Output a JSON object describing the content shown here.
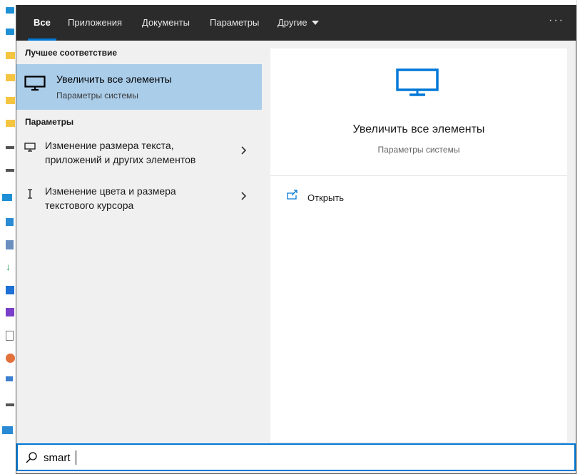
{
  "tabs": [
    {
      "label": "Все"
    },
    {
      "label": "Приложения"
    },
    {
      "label": "Документы"
    },
    {
      "label": "Параметры"
    },
    {
      "label": "Другие"
    }
  ],
  "more_button": {
    "label": "···"
  },
  "best_match": {
    "header": "Лучшее соответствие",
    "title": "Увеличить все элементы",
    "subtitle": "Параметры системы",
    "icon": "monitor-icon"
  },
  "settings_section": {
    "header": "Параметры",
    "items": [
      {
        "line1": "Изменение размера текста,",
        "line2": "приложений и других элементов",
        "icon": "monitor-icon"
      },
      {
        "line1": "Изменение цвета и размера",
        "line2": "текстового курсора",
        "icon": "text-cursor-icon"
      }
    ]
  },
  "preview": {
    "title": "Увеличить все элементы",
    "subtitle": "Параметры системы",
    "icon": "monitor-icon",
    "actions": [
      {
        "label": "Открыть",
        "icon": "open-icon"
      }
    ]
  },
  "search": {
    "value": "smart",
    "icon": "search-icon"
  },
  "colors": {
    "accent": "#0078d7",
    "selected": "#aacdea",
    "topbar": "#2b2b2b"
  }
}
